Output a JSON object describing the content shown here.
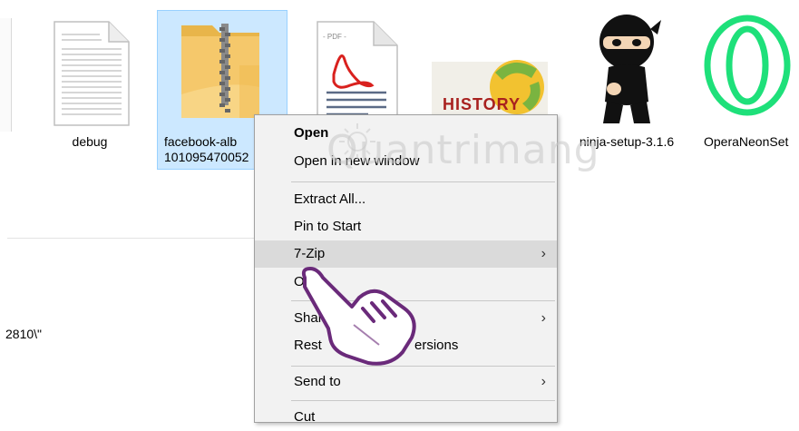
{
  "files": [
    {
      "name": "debug",
      "icon": "text-document-icon"
    },
    {
      "name": "facebook-alb",
      "name_line2": "101095470052",
      "icon": "zip-folder-icon",
      "selected": true
    },
    {
      "name": "",
      "icon": "pdf-document-icon",
      "thumb_text": "- PDF -"
    },
    {
      "name": "",
      "icon": "history-image-icon",
      "thumb_text": "HISTORY"
    },
    {
      "name": "ninja-setup-3.1.6",
      "icon": "ninja-icon"
    },
    {
      "name": "OperaNeonSet",
      "icon": "opera-neon-icon"
    }
  ],
  "path_text": "2810\\\"",
  "watermark": "Quantrimang",
  "context_menu": {
    "items": [
      {
        "label": "Open",
        "bold": true
      },
      {
        "label": "Open in new window"
      },
      {
        "label": "Extract All..."
      },
      {
        "label": "Pin to Start"
      },
      {
        "label": "7-Zip",
        "submenu": true,
        "hover": true
      },
      {
        "label": "O"
      },
      {
        "label": "Share w",
        "submenu": true
      },
      {
        "label": "Rest",
        "label_tail": "ersions"
      },
      {
        "label": "Send to",
        "submenu": true
      },
      {
        "label": "Cut"
      }
    ],
    "arrow_glyph": "›"
  },
  "colors": {
    "selection": "#cce8ff",
    "selection_border": "#99d1ff",
    "menu_bg": "#f2f2f2",
    "menu_hover": "#dadada",
    "folder_yellow": "#f5c86b",
    "pdf_red": "#d9211e",
    "opera_green": "#1ee07a",
    "cursor_purple": "#6a2a7a"
  }
}
